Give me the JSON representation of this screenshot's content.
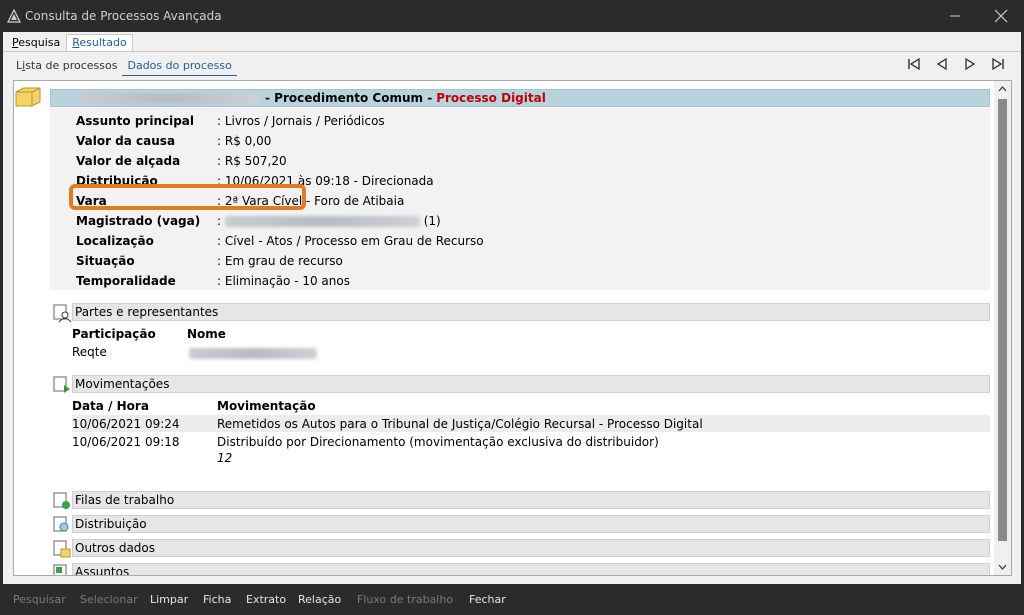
{
  "window": {
    "title": "Consulta de Processos Avançada"
  },
  "tabs": [
    {
      "label": "Pesquisa",
      "underline": "P",
      "rest": "esquisa",
      "active": false
    },
    {
      "label": "Resultado",
      "underline": "R",
      "rest": "esultado",
      "active": true
    }
  ],
  "subtabs": [
    {
      "label": "Lista de processos",
      "pre": "L",
      "u": "i",
      "post": "sta de processos",
      "active": false
    },
    {
      "label": "Dados do processo",
      "pre": "",
      "u": "D",
      "post": "ados do processo",
      "active": true
    }
  ],
  "process": {
    "class": "- Procedimento Comum -",
    "type": "Processo Digital",
    "fields": [
      {
        "label": "Assunto principal",
        "value": ": Livros / Jornais / Periódicos"
      },
      {
        "label": "Valor da causa",
        "value": ": R$ 0,00"
      },
      {
        "label": "Valor de alçada",
        "value": ": R$ 507,20"
      },
      {
        "label": "Distribuição",
        "value": ": 10/06/2021 às 09:18 - Direcionada"
      },
      {
        "label": "Vara",
        "value": ": 2ª Vara Cível - Foro de Atibaia"
      },
      {
        "label": "Magistrado (vaga)",
        "value": ":",
        "suffix": "(1)"
      },
      {
        "label": "Localização",
        "value": ": Cível - Atos / Processo em Grau de Recurso"
      },
      {
        "label": "Situação",
        "value": ": Em grau de recurso"
      },
      {
        "label": "Temporalidade",
        "value": ": Eliminação - 10 anos"
      }
    ]
  },
  "sections": {
    "partes": {
      "title": "Partes e representantes",
      "col_participacao": "Participação",
      "col_nome": "Nome",
      "rows": [
        {
          "participacao": "Reqte"
        }
      ]
    },
    "movimentacoes": {
      "title": "Movimentações",
      "col_data": "Data / Hora",
      "col_mov": "Movimentação",
      "rows": [
        {
          "data": "10/06/2021 09:24",
          "mov": "Remetidos os Autos para o Tribunal de Justiça/Colégio Recursal - Processo Digital",
          "extra": ""
        },
        {
          "data": "10/06/2021 09:18",
          "mov": "Distribuído por Direcionamento (movimentação exclusiva do distribuidor)",
          "extra": "12"
        }
      ]
    },
    "filas": {
      "title": "Filas de trabalho"
    },
    "distribuicao": {
      "title": "Distribuição"
    },
    "outros": {
      "title": "Outros dados"
    },
    "assuntos": {
      "title": "Assuntos"
    }
  },
  "buttons": [
    {
      "label": "Pesquisar",
      "enabled": false
    },
    {
      "label": "Selecionar",
      "enabled": false
    },
    {
      "label": "Limpar",
      "enabled": true
    },
    {
      "label": "Ficha",
      "enabled": true
    },
    {
      "label": "Extrato",
      "enabled": true
    },
    {
      "label": "Relação",
      "enabled": true
    },
    {
      "label": "Fluxo de trabalho",
      "enabled": false
    },
    {
      "label": "Fechar",
      "enabled": true
    }
  ],
  "colors": {
    "highlight": "#e07b1f",
    "accent": "#1f5f9a",
    "digital": "#c00000"
  }
}
